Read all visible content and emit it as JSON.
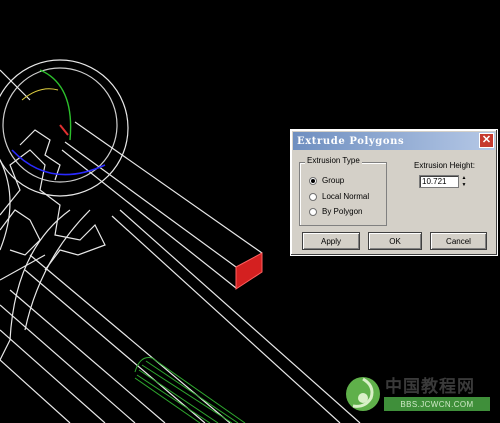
{
  "dialog": {
    "title": "Extrude Polygons",
    "close_glyph": "✕",
    "extrusion_type": {
      "label": "Extrusion Type",
      "options": [
        {
          "label": "Group",
          "selected": true
        },
        {
          "label": "Local Normal",
          "selected": false
        },
        {
          "label": "By Polygon",
          "selected": false
        }
      ]
    },
    "extrusion_height": {
      "label": "Extrusion Height:",
      "value": "10.721"
    },
    "buttons": {
      "apply": "Apply",
      "ok": "OK",
      "cancel": "Cancel"
    }
  },
  "watermark": {
    "title": "中国教程网",
    "url": "BBS.JCWCN.COM"
  },
  "colors": {
    "viewport_bg": "#000000",
    "wireframe": "#ffffff",
    "selected_face": "#d42020",
    "green_object": "#2fa82f",
    "gizmo_blue": "#2a2aff",
    "gizmo_green": "#2cc02c",
    "gizmo_red": "#e03030"
  }
}
